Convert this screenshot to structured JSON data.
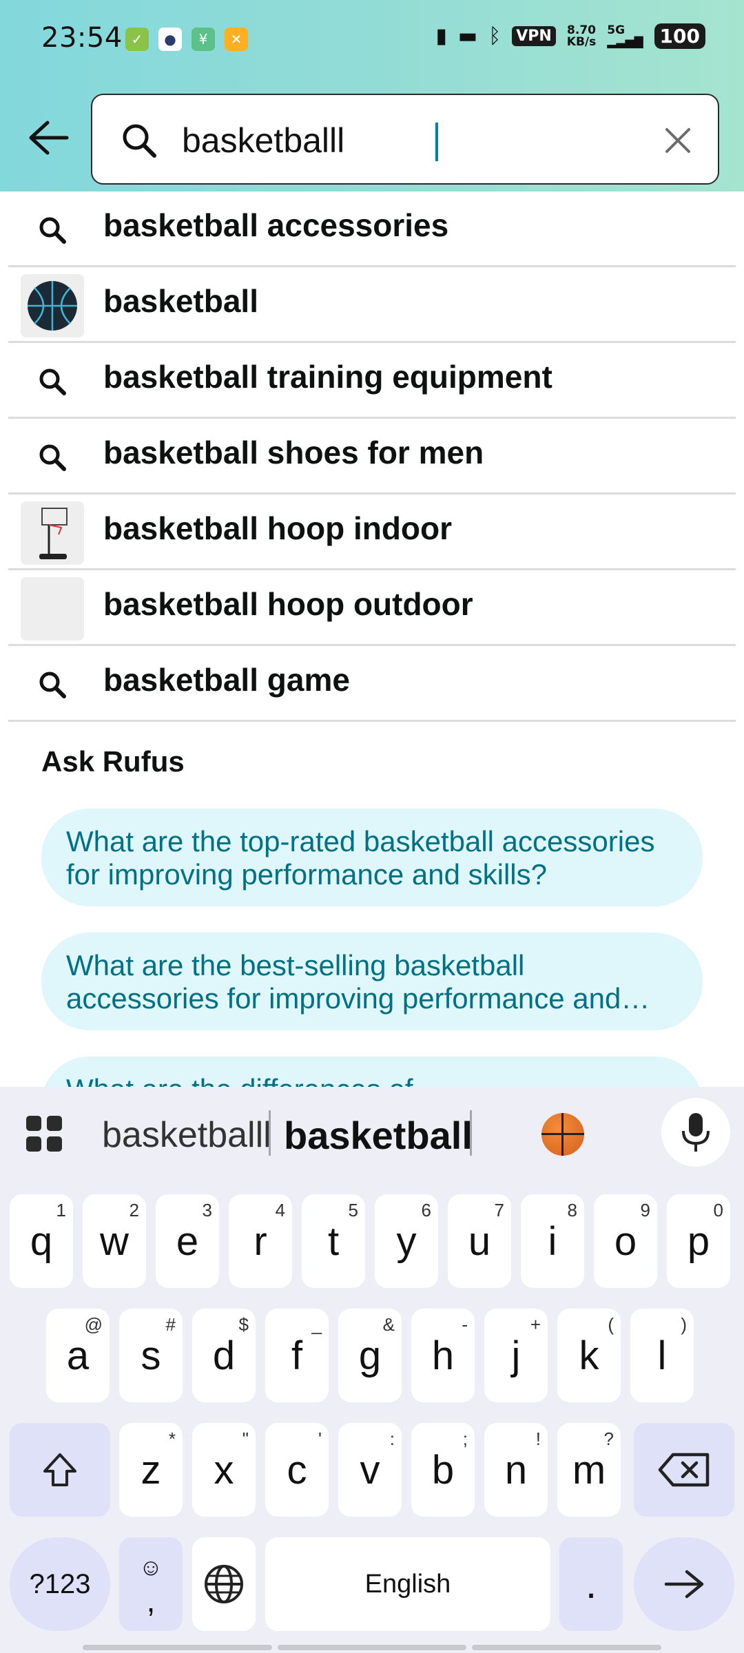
{
  "status_bar": {
    "time": "23:54",
    "net_speed_value": "8.70",
    "net_speed_unit": "KB/s",
    "vpn_label": "VPN",
    "signal_label": "5G",
    "battery": "100"
  },
  "search": {
    "query": "basketballl",
    "back_icon": "arrow-left-icon",
    "search_icon": "magnifier-icon",
    "clear_icon": "close-icon"
  },
  "suggestions": [
    {
      "text": "basketball accessories",
      "icon": "search"
    },
    {
      "text": "basketball",
      "icon": "thumbnail-basketball"
    },
    {
      "text": "basketball training equipment",
      "icon": "search"
    },
    {
      "text": "basketball shoes for men",
      "icon": "search"
    },
    {
      "text": "basketball hoop indoor",
      "icon": "thumbnail-hoop"
    },
    {
      "text": "basketball hoop outdoor",
      "icon": "thumbnail-blank"
    },
    {
      "text": "basketball game",
      "icon": "search"
    }
  ],
  "rufus": {
    "title": "Ask Rufus",
    "chips": [
      "What are the top-rated basketball accessories for improving performance and skills?",
      "What are the best-selling basketball accessories for improving performance and skills?",
      "What are the differences of"
    ]
  },
  "keyboard": {
    "suggestion_1": "basketballl",
    "suggestion_2": "basketball",
    "suggestion_emoji": "basketball-emoji",
    "row1": [
      {
        "k": "q",
        "h": "1"
      },
      {
        "k": "w",
        "h": "2"
      },
      {
        "k": "e",
        "h": "3"
      },
      {
        "k": "r",
        "h": "4"
      },
      {
        "k": "t",
        "h": "5"
      },
      {
        "k": "y",
        "h": "6"
      },
      {
        "k": "u",
        "h": "7"
      },
      {
        "k": "i",
        "h": "8"
      },
      {
        "k": "o",
        "h": "9"
      },
      {
        "k": "p",
        "h": "0"
      }
    ],
    "row2": [
      {
        "k": "a",
        "h": "@"
      },
      {
        "k": "s",
        "h": "#"
      },
      {
        "k": "d",
        "h": "$"
      },
      {
        "k": "f",
        "h": "_"
      },
      {
        "k": "g",
        "h": "&"
      },
      {
        "k": "h",
        "h": "-"
      },
      {
        "k": "j",
        "h": "+"
      },
      {
        "k": "k",
        "h": "("
      },
      {
        "k": "l",
        "h": ")"
      }
    ],
    "row3": [
      {
        "k": "z",
        "h": "*"
      },
      {
        "k": "x",
        "h": "\""
      },
      {
        "k": "c",
        "h": "'"
      },
      {
        "k": "v",
        "h": ":"
      },
      {
        "k": "b",
        "h": ";"
      },
      {
        "k": "n",
        "h": "!"
      },
      {
        "k": "m",
        "h": "?"
      }
    ],
    "symbols_label": "?123",
    "comma_label": ",",
    "space_label": "English",
    "period_label": "."
  }
}
